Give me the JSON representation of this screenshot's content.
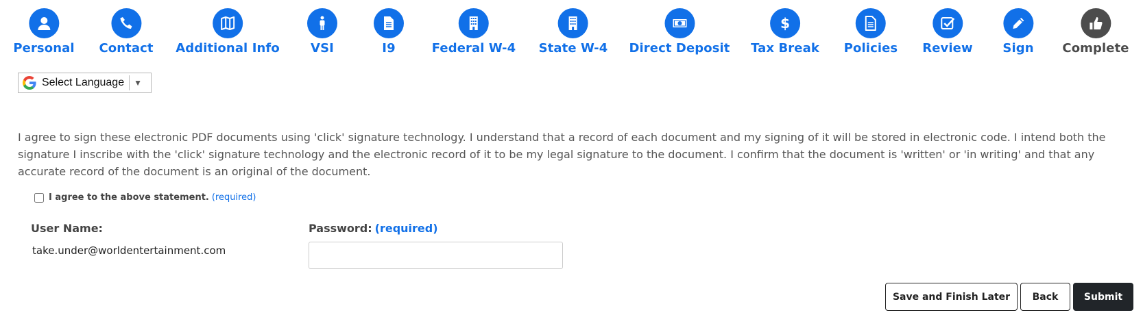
{
  "steps": [
    {
      "label": "Personal",
      "icon": "person-icon"
    },
    {
      "label": "Contact",
      "icon": "phone-icon"
    },
    {
      "label": "Additional Info",
      "icon": "map-icon"
    },
    {
      "label": "VSI",
      "icon": "standing-person-icon"
    },
    {
      "label": "I9",
      "icon": "file-icon"
    },
    {
      "label": "Federal W-4",
      "icon": "building-icon"
    },
    {
      "label": "State W-4",
      "icon": "building-icon"
    },
    {
      "label": "Direct Deposit",
      "icon": "money-bill-icon"
    },
    {
      "label": "Tax Break",
      "icon": "dollar-icon"
    },
    {
      "label": "Policies",
      "icon": "document-icon"
    },
    {
      "label": "Review",
      "icon": "checkbox-icon"
    },
    {
      "label": "Sign",
      "icon": "pencil-icon"
    },
    {
      "label": "Complete",
      "icon": "thumbs-up-icon"
    }
  ],
  "language": {
    "label": "Select Language",
    "arrow": "▼"
  },
  "statement": "I agree to sign these electronic PDF documents using 'click' signature technology. I understand that a record of each document and my signing of it will be stored in electronic code. I intend both the signature I inscribe with the 'click' signature technology and the electronic record of it to be my legal signature to the document. I confirm that the document is 'written' or 'in writing' and that any accurate record of the document is an original of the document.",
  "agree": {
    "label": "I agree to the above statement.",
    "required": "(required)"
  },
  "username": {
    "label": "User Name:",
    "value": "take.under@worldentertainment.com"
  },
  "password": {
    "label": "Password:",
    "required": "(required)",
    "value": ""
  },
  "buttons": {
    "save": "Save and Finish Later",
    "back": "Back",
    "submit": "Submit"
  },
  "colors": {
    "accent": "#1170e8",
    "complete": "#4c4c4c",
    "submit_bg": "#212529"
  }
}
